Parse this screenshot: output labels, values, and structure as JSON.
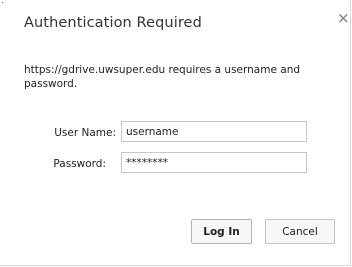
{
  "dialog": {
    "title": "Authentication Required",
    "close_glyph": "×",
    "message": "https://gdrive.uwsuper.edu requires a username and password."
  },
  "form": {
    "username_label": "User Name:",
    "username_value": "username",
    "password_label": "Password:",
    "password_value": "********"
  },
  "buttons": {
    "login_label": "Log In",
    "cancel_label": "Cancel"
  }
}
